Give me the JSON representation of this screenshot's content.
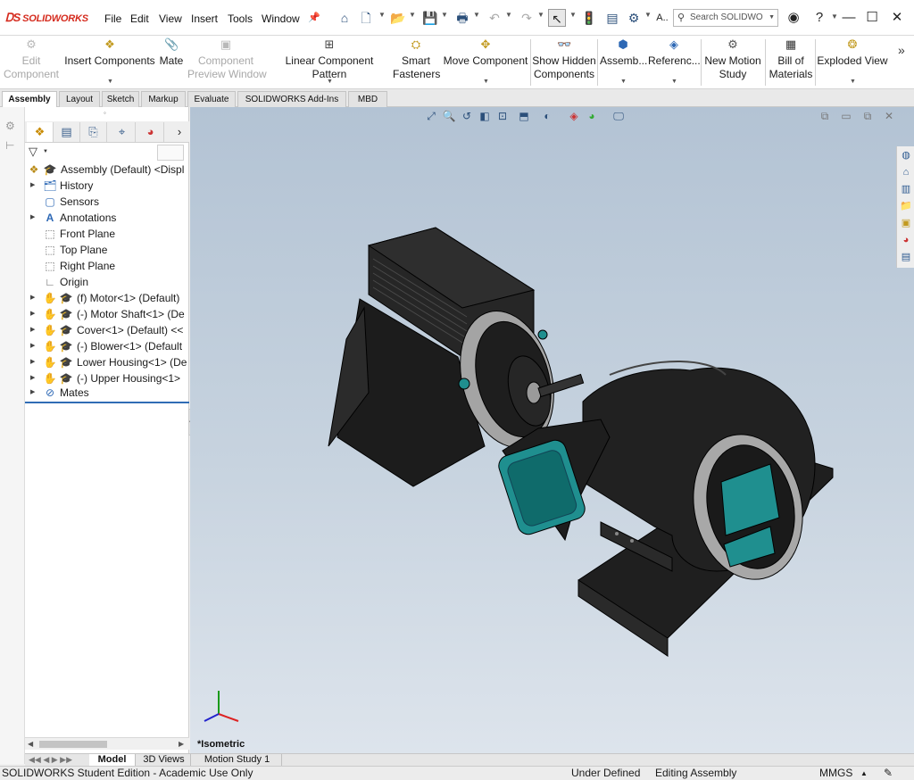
{
  "app": {
    "logo_text": "SOLIDWORKS"
  },
  "menu": [
    "File",
    "Edit",
    "View",
    "Insert",
    "Tools",
    "Window"
  ],
  "search": {
    "placeholder": "Search SOLIDWO"
  },
  "toolbar_misc": {
    "quick_a": "A.."
  },
  "commands": [
    {
      "label": "Edit\nComponent",
      "icon": "edit-component-icon",
      "enabled": false
    },
    {
      "label": "Insert Components",
      "icon": "insert-components-icon",
      "enabled": true
    },
    {
      "label": "Mate",
      "icon": "mate-paperclip-icon",
      "enabled": true
    },
    {
      "label": "Component\nPreview Window",
      "icon": "component-preview-icon",
      "enabled": false
    },
    {
      "label": "Linear Component Pattern",
      "icon": "linear-pattern-icon",
      "enabled": true
    },
    {
      "label": "Smart\nFasteners",
      "icon": "smart-fasteners-icon",
      "enabled": true
    },
    {
      "label": "Move Component",
      "icon": "move-component-icon",
      "enabled": true
    },
    {
      "label": "Show Hidden\nComponents",
      "icon": "show-hidden-icon",
      "enabled": true
    },
    {
      "label": "Assemb...",
      "icon": "assembly-features-icon",
      "enabled": true
    },
    {
      "label": "Referenc...",
      "icon": "reference-geometry-icon",
      "enabled": true
    },
    {
      "label": "New Motion\nStudy",
      "icon": "motion-study-icon",
      "enabled": true
    },
    {
      "label": "Bill of\nMaterials",
      "icon": "bom-icon",
      "enabled": true
    },
    {
      "label": "Exploded View",
      "icon": "exploded-view-icon",
      "enabled": true
    }
  ],
  "command_tabs": [
    {
      "label": "Assembly",
      "active": true
    },
    {
      "label": "Layout",
      "active": false
    },
    {
      "label": "Sketch",
      "active": false
    },
    {
      "label": "Markup",
      "active": false
    },
    {
      "label": "Evaluate",
      "active": false
    },
    {
      "label": "SOLIDWORKS Add-Ins",
      "active": false
    },
    {
      "label": "MBD",
      "active": false
    }
  ],
  "tree": {
    "root": "Assembly (Default) <Displ",
    "items": [
      {
        "label": "History",
        "icon": "history-icon",
        "expandable": true
      },
      {
        "label": "Sensors",
        "icon": "sensors-icon",
        "expandable": false
      },
      {
        "label": "Annotations",
        "icon": "annotations-icon",
        "expandable": true
      },
      {
        "label": "Front Plane",
        "icon": "plane-icon",
        "expandable": false
      },
      {
        "label": "Top Plane",
        "icon": "plane-icon",
        "expandable": false
      },
      {
        "label": "Right Plane",
        "icon": "plane-icon",
        "expandable": false
      },
      {
        "label": "Origin",
        "icon": "origin-icon",
        "expandable": false
      },
      {
        "label": "(f) Motor<1> (Default)",
        "icon": "part-icon",
        "expandable": true
      },
      {
        "label": "(-) Motor Shaft<1> (De",
        "icon": "part-icon",
        "expandable": true
      },
      {
        "label": "Cover<1> (Default) <<",
        "icon": "part-icon",
        "expandable": true
      },
      {
        "label": "(-) Blower<1> (Default",
        "icon": "part-icon",
        "expandable": true
      },
      {
        "label": "Lower Housing<1> (De",
        "icon": "part-icon",
        "expandable": true
      },
      {
        "label": "(-) Upper Housing<1>",
        "icon": "part-icon",
        "expandable": true
      },
      {
        "label": "Mates",
        "icon": "mates-icon",
        "expandable": true
      }
    ]
  },
  "viewport": {
    "view_name": "*Isometric",
    "colors": {
      "body": "#222222",
      "accent_teal": "#1f8f8f",
      "ring": "#a9a9a9"
    }
  },
  "bottom_tabs": [
    {
      "label": "Model",
      "active": true
    },
    {
      "label": "3D Views",
      "active": false
    },
    {
      "label": "Motion Study 1",
      "active": false
    }
  ],
  "status": {
    "edition": "SOLIDWORKS Student Edition - Academic Use Only",
    "definition": "Under Defined",
    "mode": "Editing Assembly",
    "units": "MMGS"
  }
}
